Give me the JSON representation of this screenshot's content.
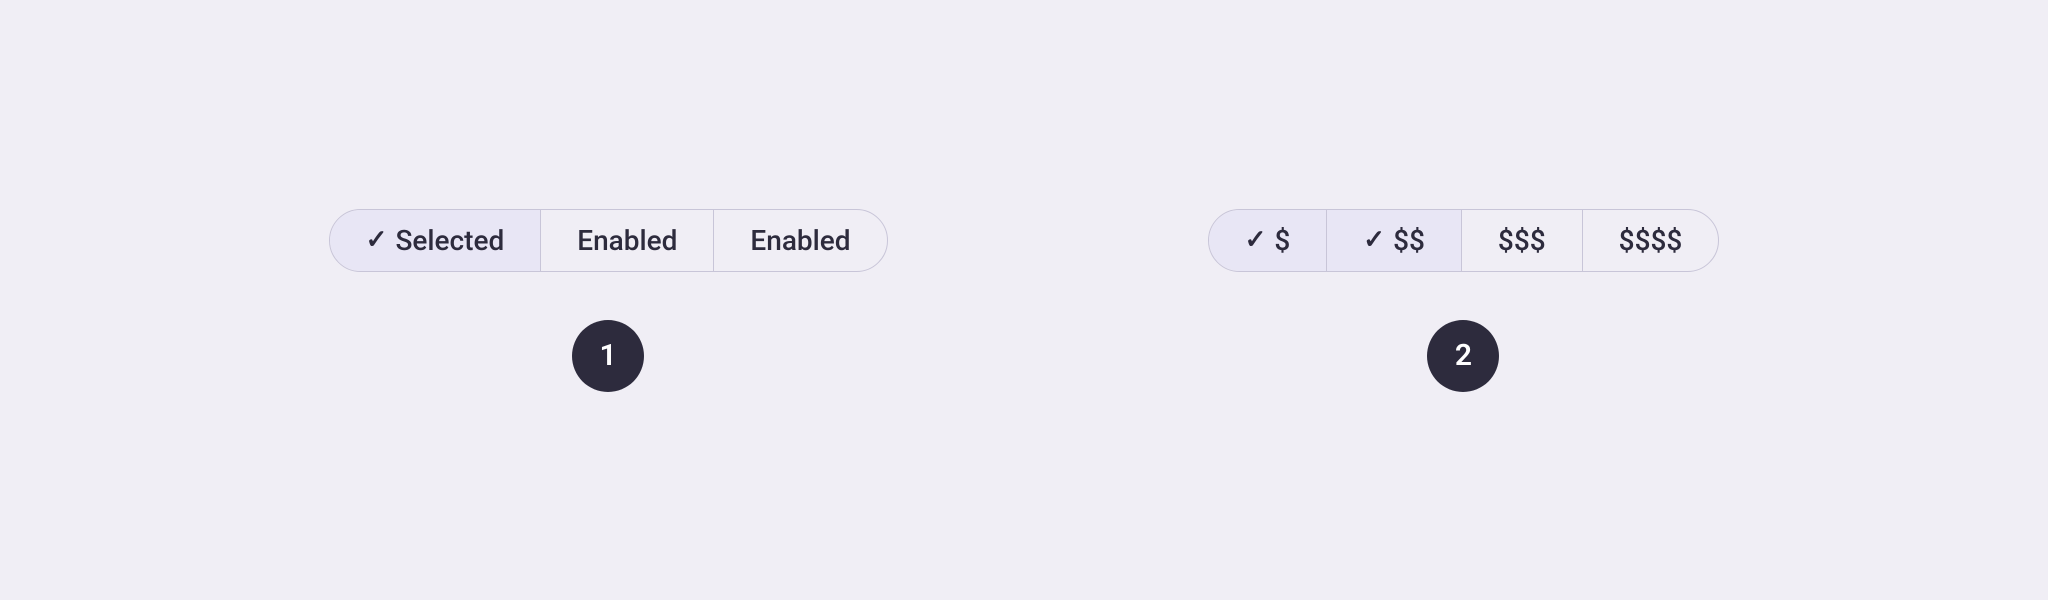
{
  "background_color": "#f0eef5",
  "examples": [
    {
      "id": 1,
      "badge_label": "1",
      "segments": [
        {
          "label": "Selected",
          "state": "selected",
          "has_check": true
        },
        {
          "label": "Enabled",
          "state": "enabled",
          "has_check": false
        },
        {
          "label": "Enabled",
          "state": "enabled-last",
          "has_check": false
        }
      ]
    },
    {
      "id": 2,
      "badge_label": "2",
      "segments": [
        {
          "label": "$",
          "state": "selected",
          "has_check": true
        },
        {
          "label": "$$",
          "state": "selected-middle",
          "has_check": true
        },
        {
          "label": "$$$",
          "state": "enabled",
          "has_check": false
        },
        {
          "label": "$$$$",
          "state": "enabled-last",
          "has_check": false
        }
      ]
    }
  ]
}
